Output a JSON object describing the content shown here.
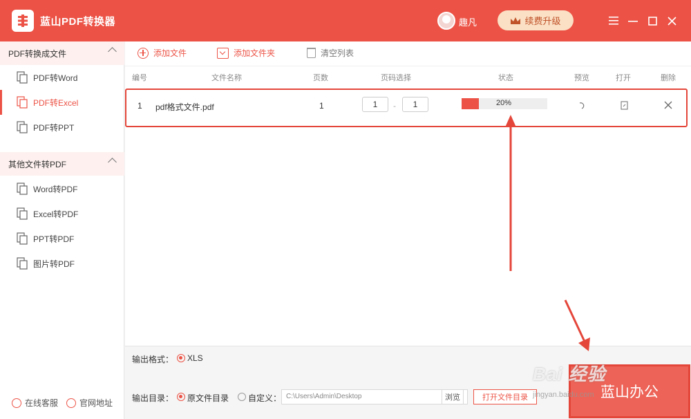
{
  "app": {
    "title": "蓝山PDF转换器",
    "username": "趣凡",
    "vip_label": "续费升级",
    "accent": "#ec5346"
  },
  "sidebar": {
    "group1": {
      "label": "PDF转换成文件",
      "items": [
        {
          "label": "PDF转Word",
          "icon": "file-convert-icon"
        },
        {
          "label": "PDF转Excel",
          "icon": "file-convert-icon"
        },
        {
          "label": "PDF转PPT",
          "icon": "file-convert-icon"
        }
      ]
    },
    "group2": {
      "label": "其他文件转PDF",
      "items": [
        {
          "label": "Word转PDF",
          "icon": "file-convert-icon"
        },
        {
          "label": "Excel转PDF",
          "icon": "file-convert-icon"
        },
        {
          "label": "PPT转PDF",
          "icon": "file-convert-icon"
        },
        {
          "label": "图片转PDF",
          "icon": "file-convert-icon"
        }
      ]
    },
    "footer": {
      "support": "在线客服",
      "feedback": "官网地址"
    }
  },
  "toolbar": {
    "add_file": "添加文件",
    "add_folder": "添加文件夹",
    "clear_list": "清空列表"
  },
  "table": {
    "headers": {
      "index": "编号",
      "filename": "文件名称",
      "pages": "页数",
      "page_select": "页码选择",
      "status": "状态",
      "preview": "预览",
      "open": "打开",
      "delete": "删除"
    },
    "rows": [
      {
        "index": "1",
        "filename": "pdf格式文件.pdf",
        "pages": "1",
        "page_from": "1",
        "page_sep": "-",
        "page_to": "1",
        "progress": 0.2,
        "progress_text": "20%"
      }
    ]
  },
  "output": {
    "format_label": "输出格式：",
    "format_value": "XLS",
    "dir_label": "输出目录：",
    "dir_option_original": "原文件目录",
    "dir_option_custom": "自定义：",
    "dir_path": "C:\\Users\\Admin\\Desktop",
    "browse": "浏览",
    "open_dir": "打开文件目录",
    "start_label": "蓝山办公"
  },
  "watermark": {
    "text": "Bai 经验",
    "sub": "jingyan.baidu.com"
  }
}
